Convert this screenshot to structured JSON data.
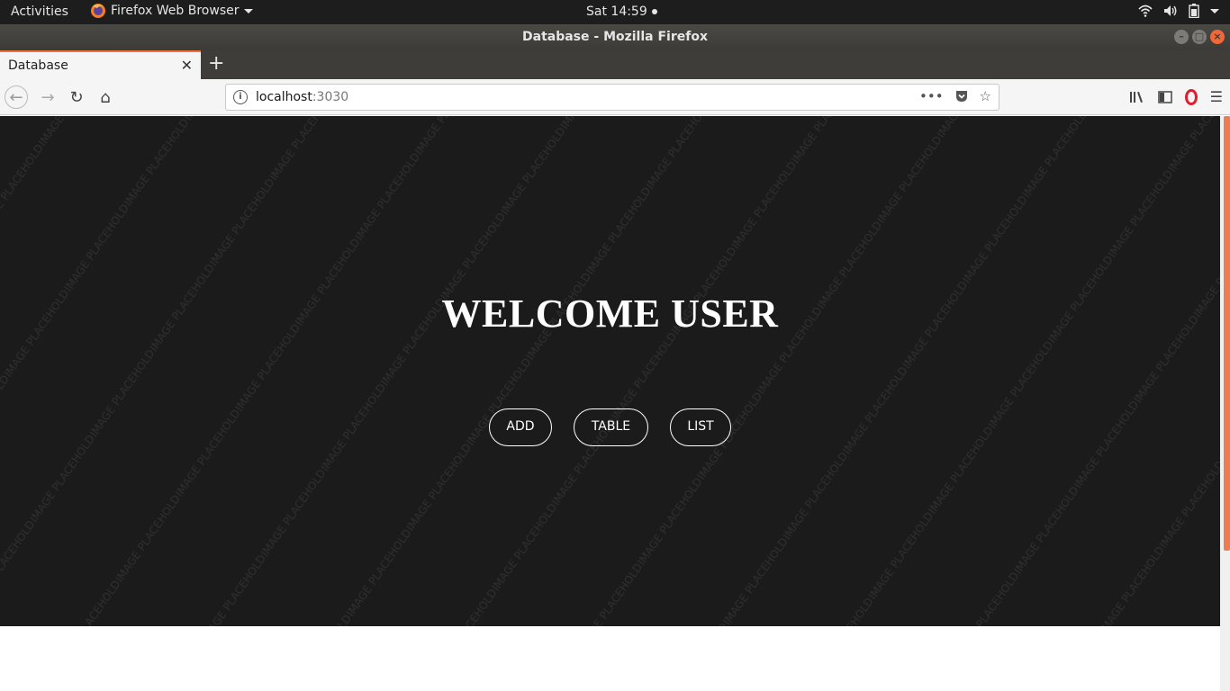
{
  "system": {
    "activities_label": "Activities",
    "app_menu_label": "Firefox Web Browser",
    "clock": "Sat 14:59"
  },
  "window": {
    "title": "Database - Mozilla Firefox"
  },
  "tabs": [
    {
      "label": "Database",
      "active": true
    }
  ],
  "urlbar": {
    "host": "localhost",
    "port": ":3030"
  },
  "page": {
    "heading": "WELCOME USER",
    "buttons": [
      {
        "label": "ADD"
      },
      {
        "label": "TABLE"
      },
      {
        "label": "LIST"
      }
    ],
    "watermark_text": "IMAGE PLACEHOLDER"
  },
  "colors": {
    "accent": "#f07241",
    "hero_bg": "#1b1b1b",
    "topbar_bg": "#1d1d1d"
  },
  "icons": [
    "firefox-icon",
    "wifi-icon",
    "volume-icon",
    "battery-icon",
    "info-icon",
    "back-icon",
    "forward-icon",
    "reload-icon",
    "home-icon",
    "more-icon",
    "pocket-icon",
    "star-icon",
    "library-icon",
    "sidebar-icon",
    "opera-icon",
    "menu-icon"
  ]
}
